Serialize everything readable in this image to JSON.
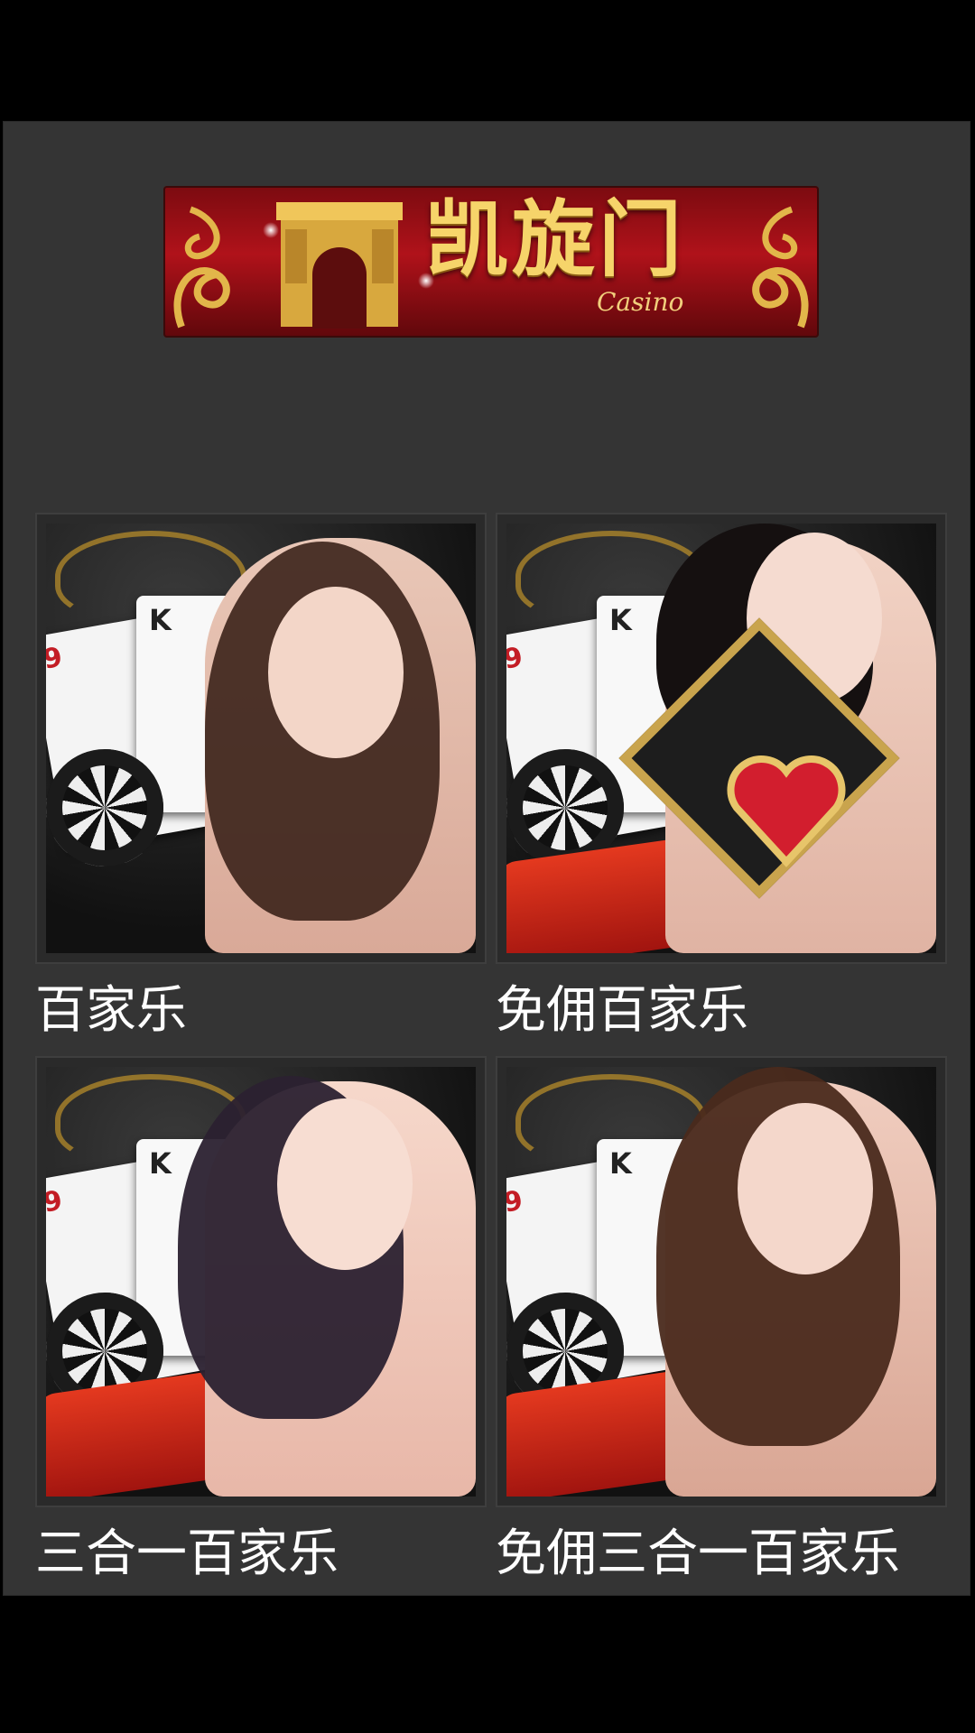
{
  "banner": {
    "brand": "凯旋门",
    "sub": "Casino"
  },
  "games": [
    {
      "label": "百家乐"
    },
    {
      "label": "免佣百家乐"
    },
    {
      "label": "三合一百家乐"
    },
    {
      "label": "免佣三合一百家乐"
    }
  ],
  "colors": {
    "page_bg": "#000000",
    "panel_bg": "#343434",
    "banner_red": "#b0121a",
    "gold": "#f6d46a",
    "label_text": "#ffffff"
  },
  "icons": {
    "logo": "arch-icon"
  }
}
